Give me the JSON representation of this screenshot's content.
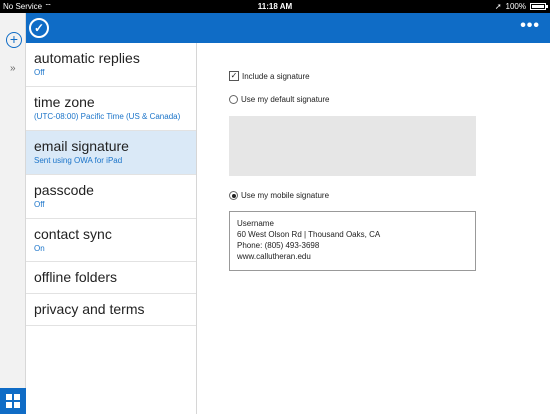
{
  "status_bar": {
    "carrier": "No Service",
    "wifi_icon": "wifi-icon",
    "time": "11:18 AM",
    "battery": "100%",
    "location_icon": "location-arrow-icon"
  },
  "app_bar": {
    "confirm_icon": "checkmark-circle-icon",
    "more_label": "•••"
  },
  "rail": {
    "add_icon": "plus-circle-icon",
    "expand_label": "»",
    "apps_icon": "app-grid-icon"
  },
  "settings": {
    "items": [
      {
        "title": "automatic replies",
        "subtitle": "Off"
      },
      {
        "title": "time zone",
        "subtitle": "(UTC-08:00) Pacific Time (US & Canada)"
      },
      {
        "title": "email signature",
        "subtitle": "Sent using OWA for iPad"
      },
      {
        "title": "passcode",
        "subtitle": "Off"
      },
      {
        "title": "contact sync",
        "subtitle": "On"
      },
      {
        "title": "offline folders"
      },
      {
        "title": "privacy and terms"
      }
    ],
    "selected_index": 2
  },
  "signature": {
    "include_label": "Include a signature",
    "include_checked": true,
    "default_label": "Use my default signature",
    "default_selected": false,
    "mobile_label": "Use my mobile signature",
    "mobile_selected": true,
    "mobile_lines": [
      "Username",
      "60 West Olson Rd | Thousand Oaks, CA",
      "Phone: (805) 493-3698",
      "www.callutheran.edu"
    ]
  },
  "colors": {
    "accent": "#0f6cc6",
    "selected_bg": "#dae9f7",
    "subtitle": "#1b74c9"
  }
}
